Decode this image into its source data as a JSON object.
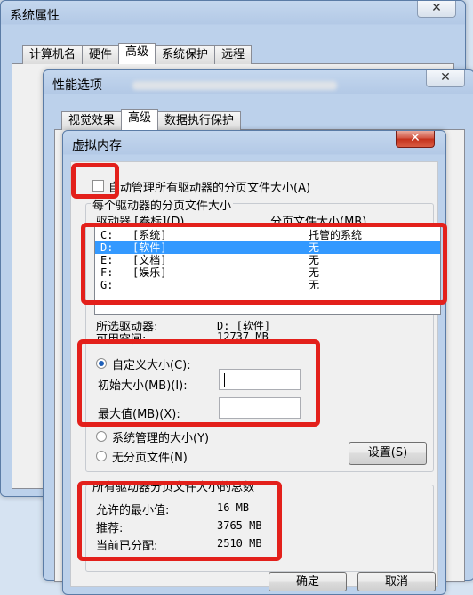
{
  "sysprops": {
    "title": "系统属性",
    "tabs": [
      "计算机名",
      "硬件",
      "高级",
      "系统保护",
      "远程"
    ]
  },
  "perf": {
    "title": "性能选项",
    "tabs": [
      "视觉效果",
      "高级",
      "数据执行保护"
    ]
  },
  "vm": {
    "title": "虚拟内存",
    "auto_manage": "自动管理所有驱动器的分页文件大小(A)",
    "group_title": "每个驱动器的分页文件大小",
    "col_drive": "驱动器 [卷标](D)",
    "col_size": "分页文件大小(MB)",
    "drives": [
      {
        "drive": "C:",
        "label": "[系统]",
        "size": "托管的系统"
      },
      {
        "drive": "D:",
        "label": "[软件]",
        "size": "无"
      },
      {
        "drive": "E:",
        "label": "[文档]",
        "size": "无"
      },
      {
        "drive": "F:",
        "label": "[娱乐]",
        "size": "无"
      },
      {
        "drive": "G:",
        "label": "",
        "size": "无"
      }
    ],
    "selected_drive_label": "所选驱动器:",
    "selected_drive_value": "D:  [软件]",
    "space_label": "可用空间:",
    "space_value": "12737 MB",
    "custom_size": "自定义大小(C):",
    "initial_size_label": "初始大小(MB)(I):",
    "max_size_label": "最大值(MB)(X):",
    "system_managed": "系统管理的大小(Y)",
    "no_paging": "无分页文件(N)",
    "set_button": "设置(S)",
    "total_title": "所有驱动器分页文件大小的总数",
    "min_allowed_label": "允许的最小值:",
    "min_allowed_value": "16 MB",
    "recommended_label": "推荐:",
    "recommended_value": "3765 MB",
    "allocated_label": "当前已分配:",
    "allocated_value": "2510 MB",
    "ok_button": "确定",
    "cancel_button": "取消"
  },
  "colors": {
    "highlight": "#e3201b",
    "selection": "#3399ff"
  }
}
